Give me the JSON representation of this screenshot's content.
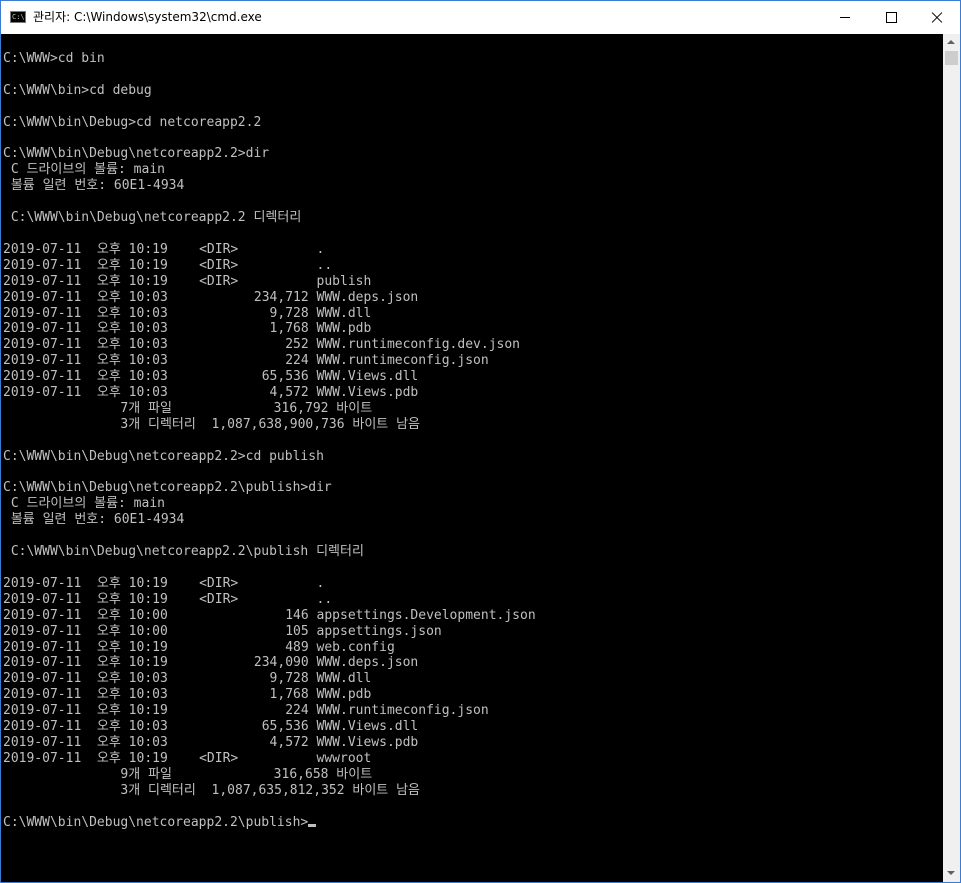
{
  "window": {
    "title": "관리자: C:\\Windows\\system32\\cmd.exe",
    "icon": "cmd-app-icon",
    "icon_text": "C:\\"
  },
  "console": {
    "lines": [
      "C:\\WWW>cd bin",
      "",
      "C:\\WWW\\bin>cd debug",
      "",
      "C:\\WWW\\bin\\Debug>cd netcoreapp2.2",
      "",
      "C:\\WWW\\bin\\Debug\\netcoreapp2.2>dir",
      " C 드라이브의 볼륨: main",
      " 볼륨 일련 번호: 60E1-4934",
      "",
      " C:\\WWW\\bin\\Debug\\netcoreapp2.2 디렉터리",
      "",
      "2019-07-11  오후 10:19    <DIR>          .",
      "2019-07-11  오후 10:19    <DIR>          ..",
      "2019-07-11  오후 10:19    <DIR>          publish",
      "2019-07-11  오후 10:03           234,712 WWW.deps.json",
      "2019-07-11  오후 10:03             9,728 WWW.dll",
      "2019-07-11  오후 10:03             1,768 WWW.pdb",
      "2019-07-11  오후 10:03               252 WWW.runtimeconfig.dev.json",
      "2019-07-11  오후 10:03               224 WWW.runtimeconfig.json",
      "2019-07-11  오후 10:03            65,536 WWW.Views.dll",
      "2019-07-11  오후 10:03             4,572 WWW.Views.pdb",
      "               7개 파일             316,792 바이트",
      "               3개 디렉터리  1,087,638,900,736 바이트 남음",
      "",
      "C:\\WWW\\bin\\Debug\\netcoreapp2.2>cd publish",
      "",
      "C:\\WWW\\bin\\Debug\\netcoreapp2.2\\publish>dir",
      " C 드라이브의 볼륨: main",
      " 볼륨 일련 번호: 60E1-4934",
      "",
      " C:\\WWW\\bin\\Debug\\netcoreapp2.2\\publish 디렉터리",
      "",
      "2019-07-11  오후 10:19    <DIR>          .",
      "2019-07-11  오후 10:19    <DIR>          ..",
      "2019-07-11  오후 10:00               146 appsettings.Development.json",
      "2019-07-11  오후 10:00               105 appsettings.json",
      "2019-07-11  오후 10:19               489 web.config",
      "2019-07-11  오후 10:19           234,090 WWW.deps.json",
      "2019-07-11  오후 10:03             9,728 WWW.dll",
      "2019-07-11  오후 10:03             1,768 WWW.pdb",
      "2019-07-11  오후 10:19               224 WWW.runtimeconfig.json",
      "2019-07-11  오후 10:03            65,536 WWW.Views.dll",
      "2019-07-11  오후 10:03             4,572 WWW.Views.pdb",
      "2019-07-11  오후 10:19    <DIR>          wwwroot",
      "               9개 파일             316,658 바이트",
      "               3개 디렉터리  1,087,635,812,352 바이트 남음",
      "",
      "C:\\WWW\\bin\\Debug\\netcoreapp2.2\\publish>"
    ],
    "colors": {
      "background": "#000000",
      "text": "#c0c0c0"
    }
  },
  "title_buttons": {
    "minimize_icon": "minimize-icon",
    "maximize_icon": "maximize-icon",
    "close_icon": "close-icon"
  },
  "colors": {
    "window_border": "#3c7bd4",
    "titlebar": "#ffffff"
  }
}
